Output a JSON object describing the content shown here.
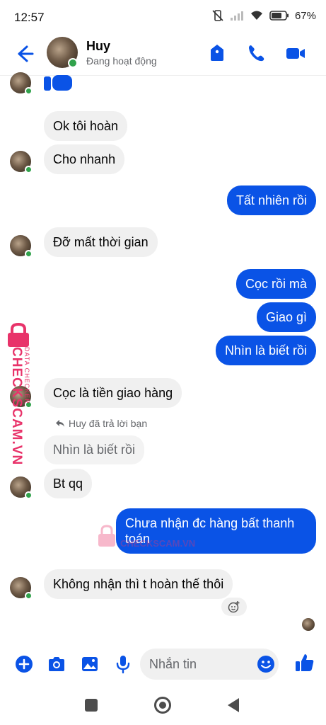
{
  "status_bar": {
    "time": "12:57",
    "battery": "67%"
  },
  "header": {
    "contact_name": "Huy",
    "contact_status": "Đang hoạt động"
  },
  "messages": {
    "m1": "Ok tôi hoàn",
    "m2": "Cho nhanh",
    "m3": "Tất nhiên rồi",
    "m4": "Đỡ mất thời gian",
    "m5": "Cọc rồi mà",
    "m6": "Giao gì",
    "m7": "Nhìn là biết rồi",
    "m8": "Cọc là tiền giao hàng",
    "reply_note": "Huy đã trả lời bạn",
    "replied_quote": "Nhìn là biết rồi",
    "m9": "Bt qq",
    "m10": "Chưa nhận đc hàng bất thanh toán",
    "m11": "Không nhận thì t hoàn thế thôi"
  },
  "watermark": {
    "brand": "CHECKSCAM.VN",
    "tag": "DATA CHECKER",
    "overlay": "CHECKSCAM.VN"
  },
  "composer": {
    "placeholder": "Nhắn tin"
  },
  "colors": {
    "accent": "#0a53e6",
    "online": "#31a24c",
    "watermark": "#e8336a"
  }
}
